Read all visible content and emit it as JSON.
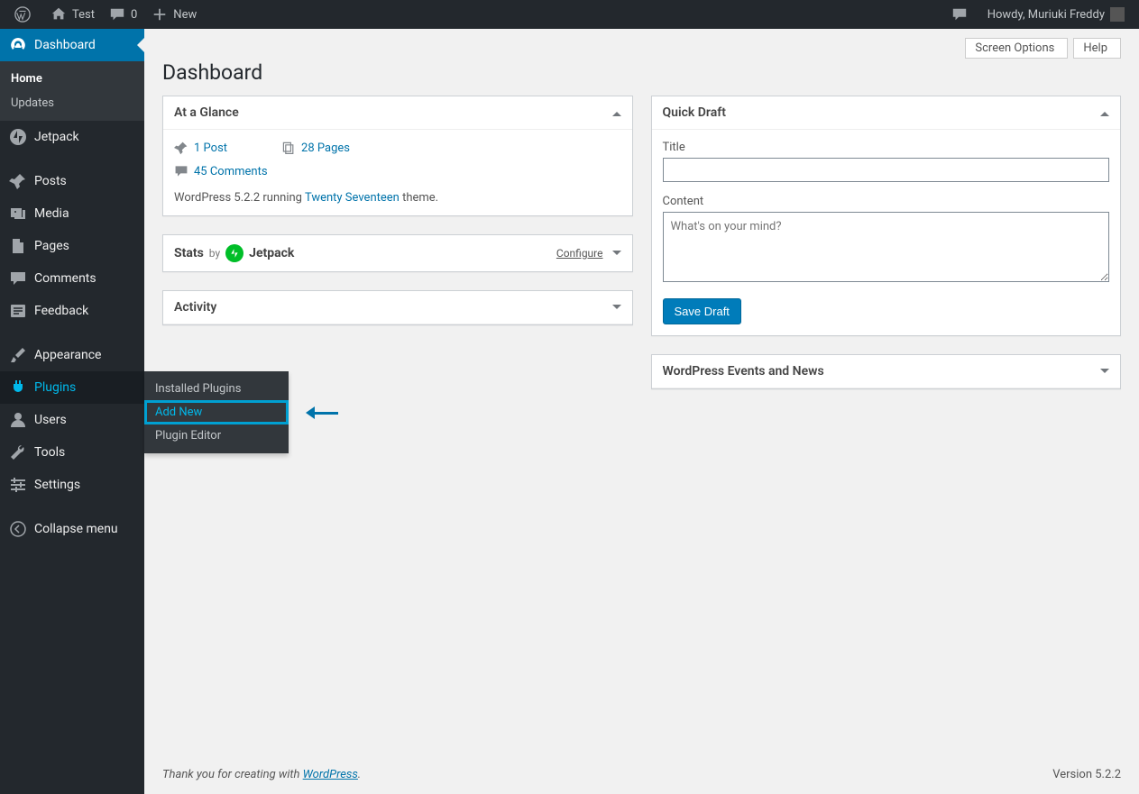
{
  "adminbar": {
    "site_name": "Test",
    "comments_count": "0",
    "new_label": "New",
    "howdy": "Howdy, Muriuki Freddy"
  },
  "topbuttons": {
    "screen_options": "Screen Options",
    "help": "Help"
  },
  "page_title": "Dashboard",
  "sidebar": {
    "dashboard": "Dashboard",
    "home": "Home",
    "updates": "Updates",
    "jetpack": "Jetpack",
    "posts": "Posts",
    "media": "Media",
    "pages": "Pages",
    "comments": "Comments",
    "feedback": "Feedback",
    "appearance": "Appearance",
    "plugins": "Plugins",
    "users": "Users",
    "tools": "Tools",
    "settings": "Settings",
    "collapse": "Collapse menu"
  },
  "flyout": {
    "installed": "Installed Plugins",
    "add_new": "Add New",
    "editor": "Plugin Editor"
  },
  "glance": {
    "title": "At a Glance",
    "post": "1 Post",
    "pages": "28 Pages",
    "comments": "45 Comments",
    "version_pre": "WordPress 5.2.2 running ",
    "theme": "Twenty Seventeen",
    "version_post": " theme."
  },
  "stats": {
    "label_pre": "Stats",
    "label_by": "by",
    "jetpack": "Jetpack",
    "configure": "Configure"
  },
  "activity": {
    "title": "Activity"
  },
  "quickdraft": {
    "title": "Quick Draft",
    "title_label": "Title",
    "content_label": "Content",
    "placeholder": "What's on your mind?",
    "save": "Save Draft"
  },
  "events": {
    "title": "WordPress Events and News"
  },
  "footer": {
    "thanks_pre": "Thank you for creating with ",
    "wp": "WordPress",
    "version": "Version 5.2.2"
  }
}
